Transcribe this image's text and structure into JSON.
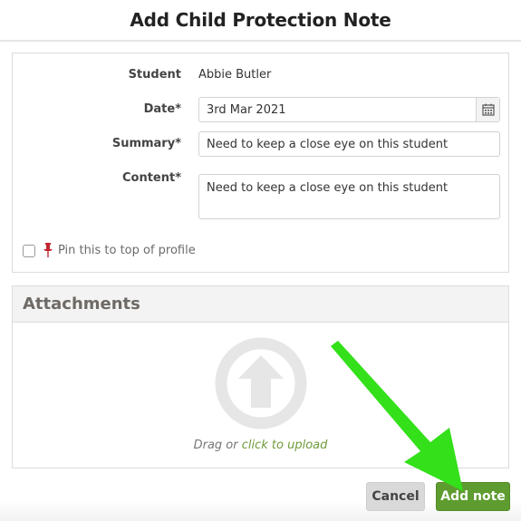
{
  "dialog": {
    "title": "Add Child Protection Note"
  },
  "form": {
    "student_label": "Student",
    "student_value": "Abbie Butler",
    "date_label": "Date*",
    "date_value": "3rd Mar 2021",
    "summary_label": "Summary*",
    "summary_value": "Need to keep a close eye on this student",
    "content_label": "Content*",
    "content_value": "Need to keep a close eye on this student",
    "pin_label": "Pin this to top of profile",
    "pin_checked": false
  },
  "attachments": {
    "title": "Attachments",
    "drag_text": "Drag or",
    "upload_link": "click to upload"
  },
  "footer": {
    "cancel_label": "Cancel",
    "add_label": "Add note"
  },
  "colors": {
    "primary_button": "#5e9c2f",
    "link": "#6f9b3a",
    "pin": "#c0282d",
    "annotation_arrow": "#33e01a"
  },
  "icons": [
    "calendar-icon",
    "pin-icon",
    "upload-arrow-icon"
  ]
}
